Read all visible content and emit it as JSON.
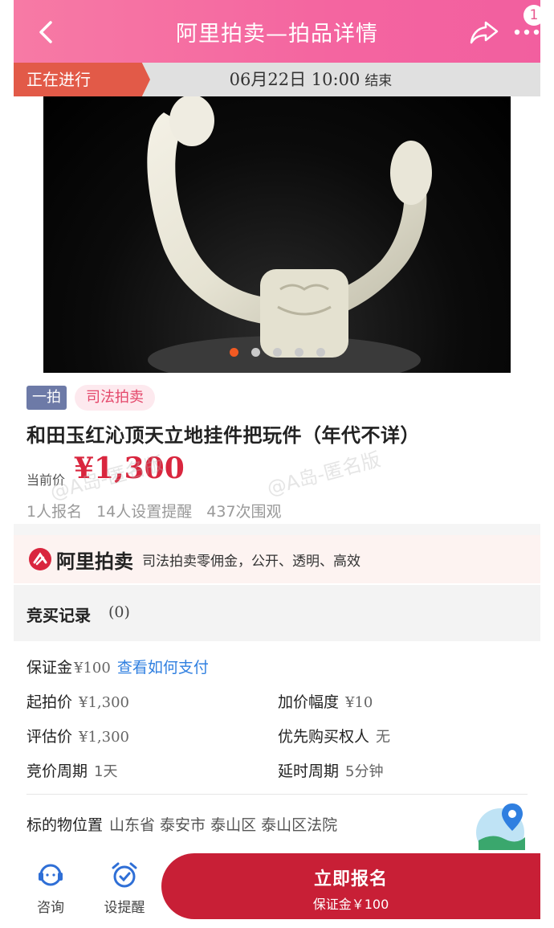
{
  "header": {
    "title": "阿里拍卖—拍品详情",
    "notification_count": "1"
  },
  "status": {
    "tag": "正在进行",
    "end_time": "06月22日 10:00",
    "end_suffix": "结束"
  },
  "gallery": {
    "image_count": 5,
    "active_index": 0
  },
  "tags": {
    "round": "一拍",
    "type": "司法拍卖"
  },
  "item": {
    "title": "和田玉红沁顶天立地挂件把玩件（年代不详）",
    "price_label": "当前价",
    "price": "¥1,300",
    "stats": {
      "signups": "1人报名",
      "reminders": "14人设置提醒",
      "views": "437次围观"
    }
  },
  "watermark": "@A岛-匿名版",
  "banner": {
    "brand": "阿里拍卖",
    "slogan": "司法拍卖零佣金，公开、透明、高效"
  },
  "bid_record": {
    "label": "竞买记录",
    "count": "(0)"
  },
  "details": {
    "deposit_label": "保证金",
    "deposit_value": "¥100",
    "deposit_link": "查看如何支付",
    "start_price_label": "起拍价",
    "start_price_value": "¥1,300",
    "increment_label": "加价幅度",
    "increment_value": "¥10",
    "appraisal_label": "评估价",
    "appraisal_value": "¥1,300",
    "priority_label": "优先购买权人",
    "priority_value": "无",
    "cycle_label": "竞价周期",
    "cycle_value": "1天",
    "delay_label": "延时周期",
    "delay_value": "5分钟",
    "location_label": "标的物位置",
    "location_value": "山东省 泰安市 泰山区 泰山区法院"
  },
  "bottom": {
    "consult": "咨询",
    "reminder": "设提醒",
    "cta_main": "立即报名",
    "cta_sub": "保证金￥100"
  },
  "colors": {
    "header_pink": "#f465a0",
    "price_red": "#d9263e",
    "cta_red": "#c81f36",
    "link_blue": "#2f7fe0"
  }
}
